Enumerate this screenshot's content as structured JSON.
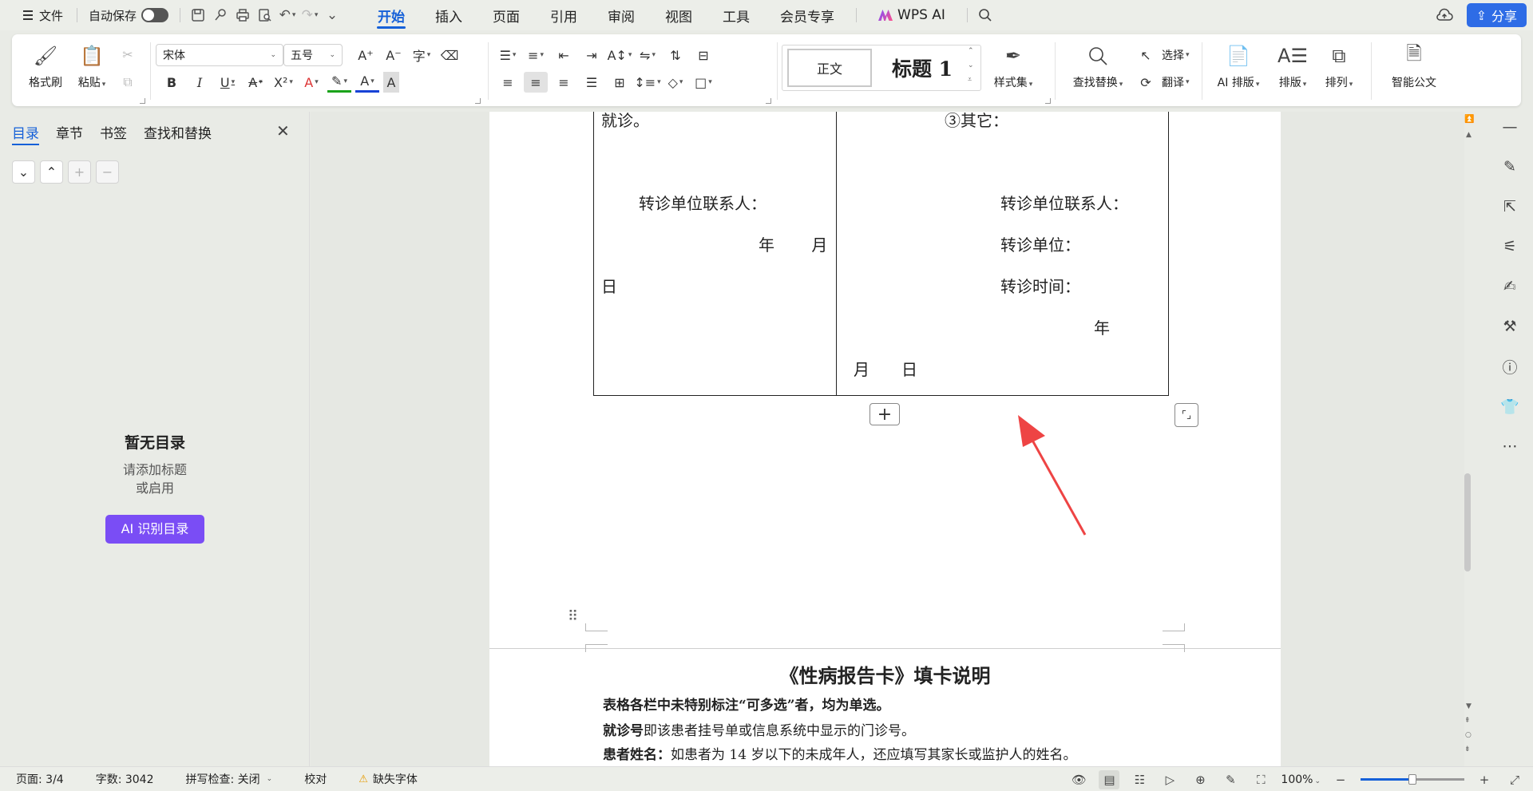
{
  "menubar": {
    "file_label": "文件",
    "autosave_label": "自动保存",
    "tabs": [
      "开始",
      "插入",
      "页面",
      "引用",
      "审阅",
      "视图",
      "工具",
      "会员专享"
    ],
    "active_tab": "开始",
    "wps_ai_label": "WPS AI",
    "share_label": "分享"
  },
  "ribbon": {
    "format_painter": "格式刷",
    "paste": "粘贴",
    "font_name": "宋体",
    "font_size": "五号",
    "style_normal": "正文",
    "style_heading1": "标题 1",
    "style_set": "样式集",
    "find_replace": "查找替换",
    "select": "选择",
    "translate": "翻译",
    "ai_layout": "AI 排版",
    "layout": "排版",
    "arrange": "排列",
    "smart_doc": "智能公文"
  },
  "leftpanel": {
    "tabs": [
      "目录",
      "章节",
      "书签",
      "查找和替换"
    ],
    "active_tab": "目录",
    "empty_title": "暂无目录",
    "empty_hint_line1": "请添加标题",
    "empty_hint_line2": "或启用",
    "ai_button": "AI 识别目录"
  },
  "document": {
    "left_cell": {
      "line1": "就诊。",
      "contact": "转诊单位联系人：",
      "year_month": "年　　 月",
      "day": "日"
    },
    "right_cell": {
      "other": "③其它：",
      "contact": "转诊单位联系人：",
      "unit": "转诊单位：",
      "time": "转诊时间：",
      "year": "年",
      "month_day": "月　　日"
    },
    "page2": {
      "title": "《性病报告卡》填卡说明",
      "line1": "表格各栏中未特别标注“可多选”者，均为单选。",
      "line2_label": "就诊号",
      "line2_text": "即该患者挂号单或信息系统中显示的门诊号。",
      "line3_label": "患者姓名：",
      "line3_text": "如患者为 14 岁以下的未成年人，还应填写其家长或监护人的姓名。"
    }
  },
  "statusbar": {
    "page": "页面: 3/4",
    "word_count": "字数: 3042",
    "spell_check": "拼写检查: 关闭",
    "proofread": "校对",
    "missing_font": "缺失字体",
    "zoom": "100%"
  }
}
